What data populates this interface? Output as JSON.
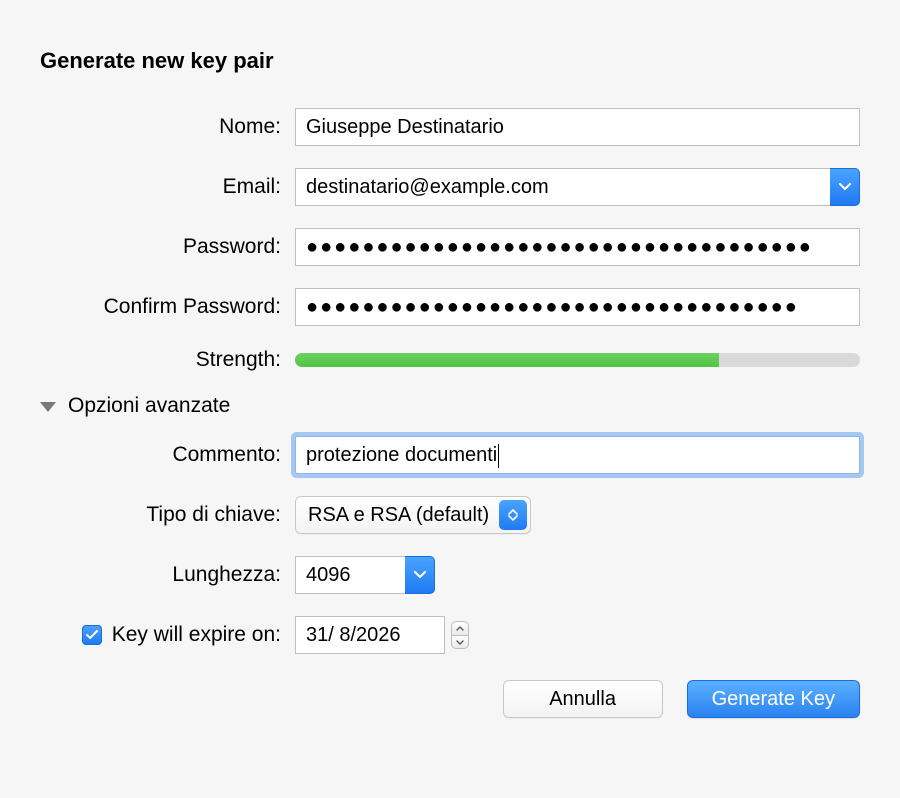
{
  "title": "Generate new key pair",
  "fields": {
    "name": {
      "label": "Nome:",
      "value": "Giuseppe Destinatario"
    },
    "email": {
      "label": "Email:",
      "value": "destinatario@example.com"
    },
    "password": {
      "label": "Password:",
      "value": "●●●●●●●●●●●●●●●●●●●●●●●●●●●●●●●●●●●●"
    },
    "confirm": {
      "label": "Confirm Password:",
      "value": "●●●●●●●●●●●●●●●●●●●●●●●●●●●●●●●●●●●"
    },
    "strength": {
      "label": "Strength:",
      "percent": 75
    }
  },
  "advanced": {
    "header": "Opzioni avanzate",
    "comment": {
      "label": "Commento:",
      "value": "protezione documenti"
    },
    "keytype": {
      "label": "Tipo di chiave:",
      "value": "RSA e RSA (default)"
    },
    "length": {
      "label": "Lunghezza:",
      "value": "4096"
    },
    "expire": {
      "checked": true,
      "label": "Key will expire on:",
      "value": "31/ 8/2026"
    }
  },
  "buttons": {
    "cancel": "Annulla",
    "generate": "Generate Key"
  }
}
